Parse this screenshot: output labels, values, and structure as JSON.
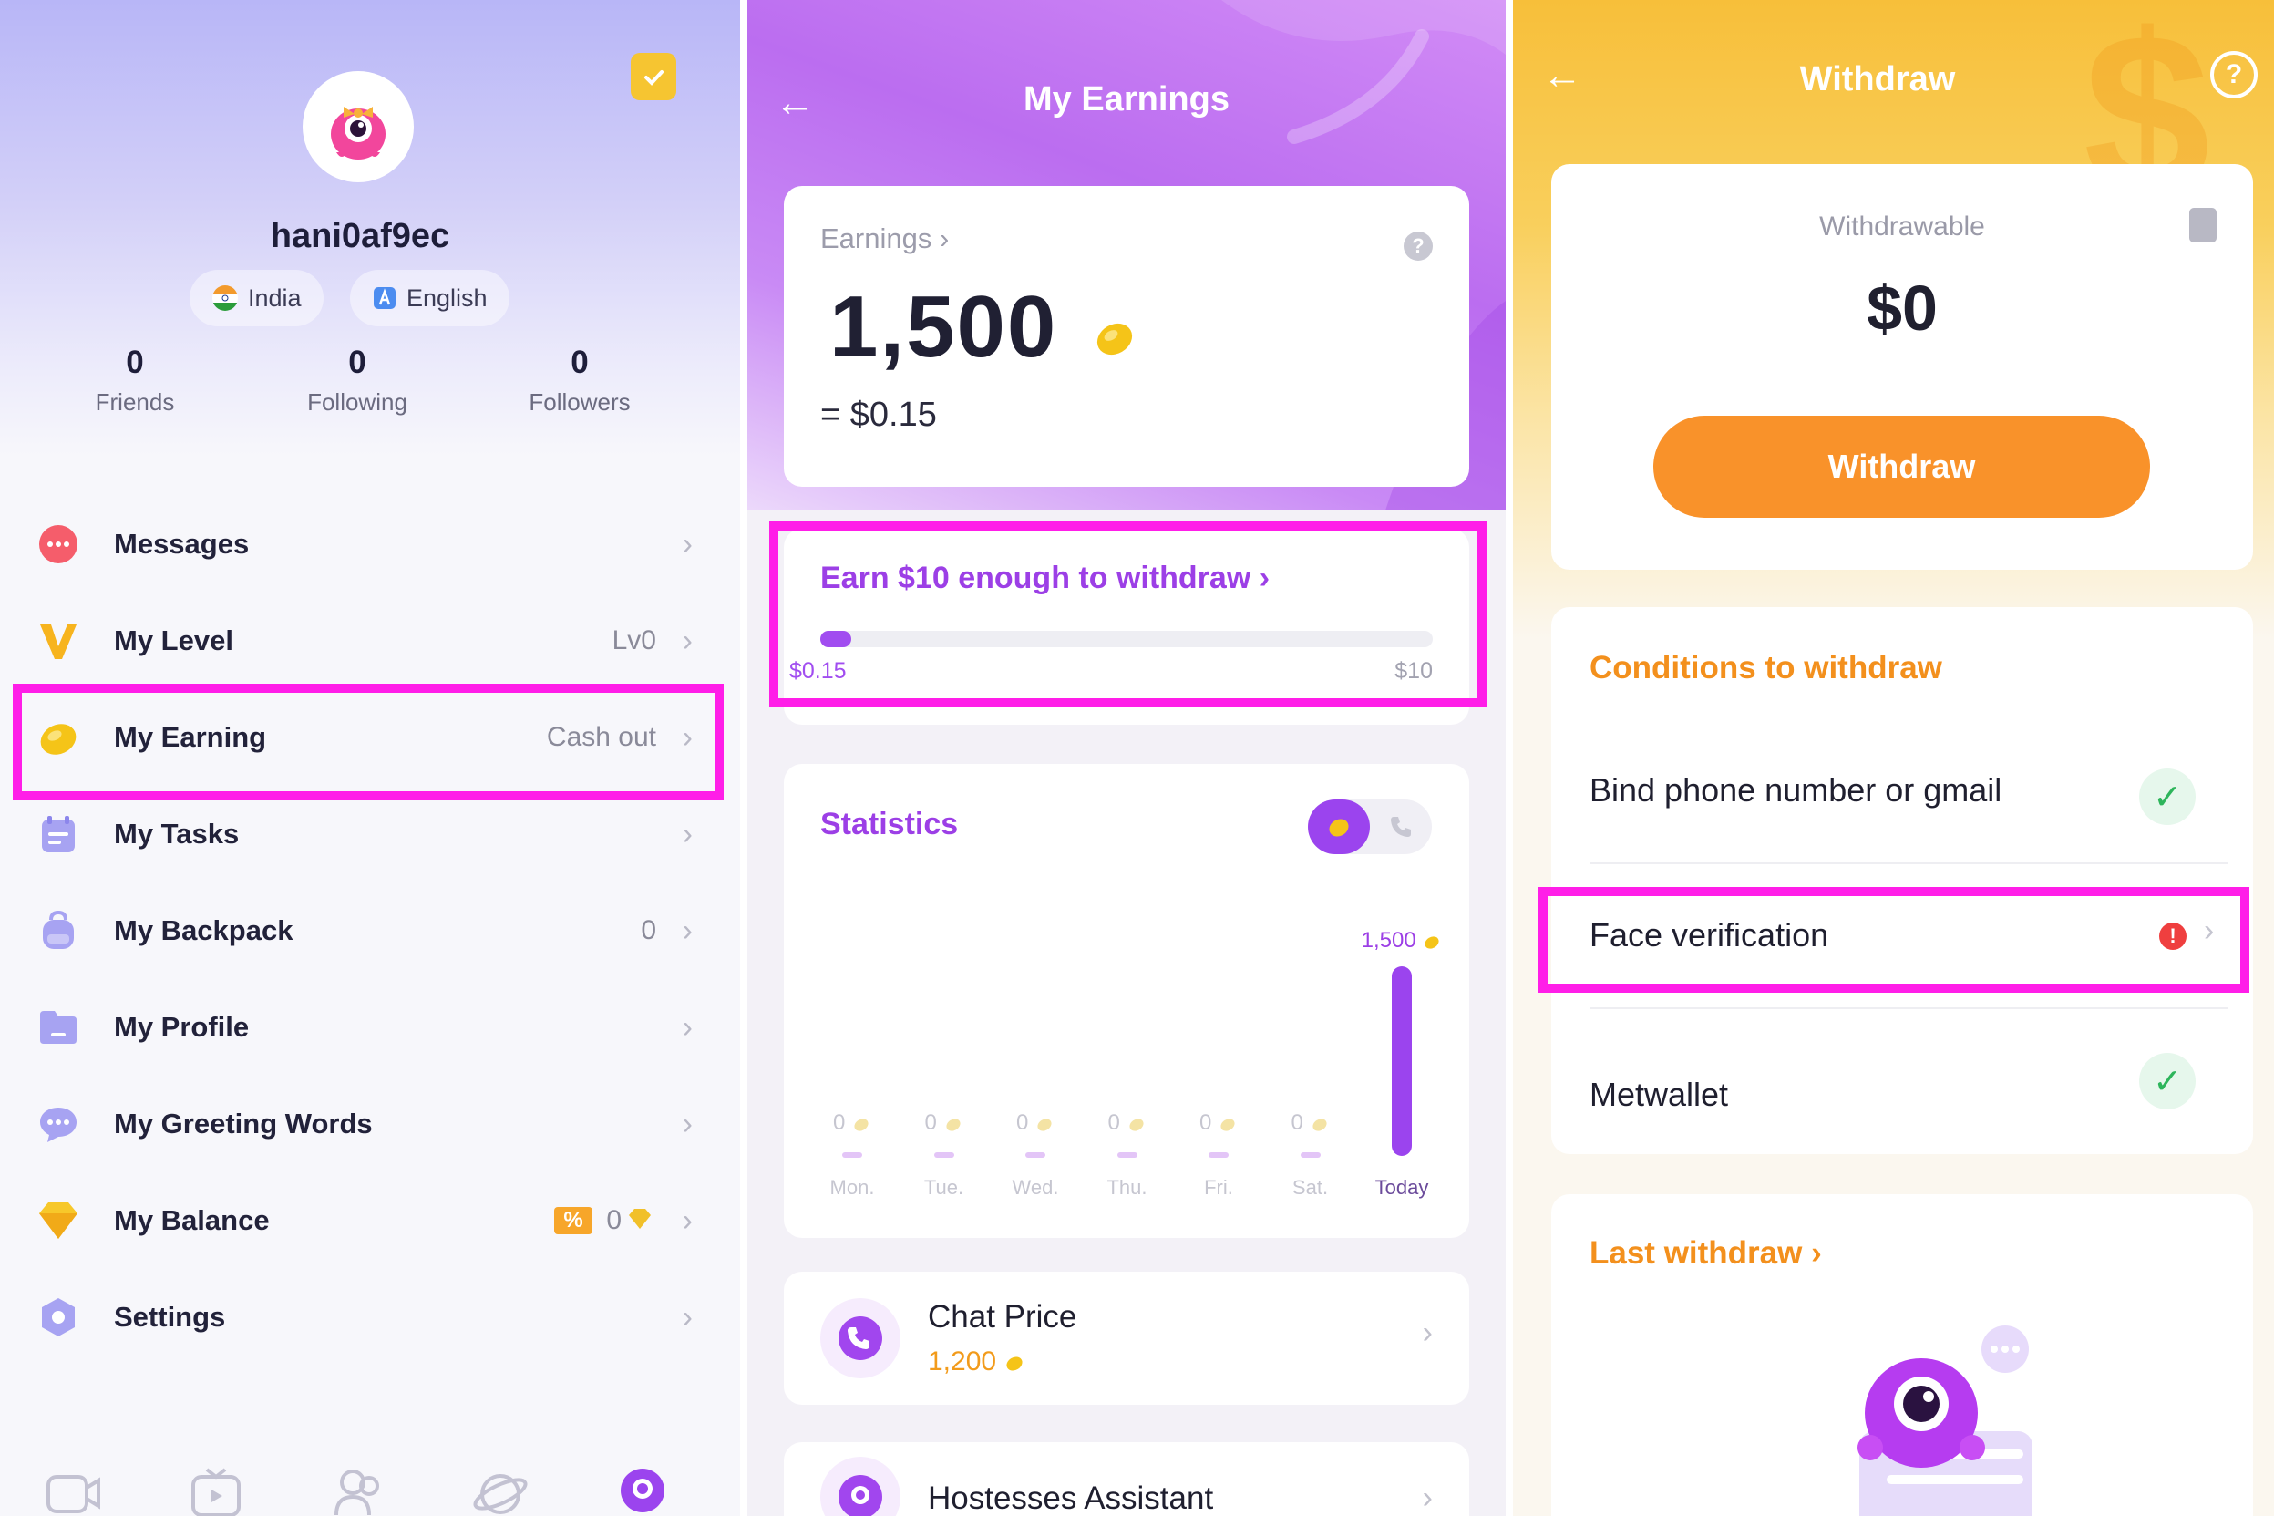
{
  "profile_screen": {
    "username": "hani0af9ec",
    "country_chip": "India",
    "language_chip": "English",
    "stats": [
      {
        "value": "0",
        "label": "Friends"
      },
      {
        "value": "0",
        "label": "Following"
      },
      {
        "value": "0",
        "label": "Followers"
      }
    ],
    "menu": [
      {
        "label": "Messages",
        "value": "",
        "icon": "chat-bubble-icon"
      },
      {
        "label": "My Level",
        "value": "Lv0",
        "icon": "level-v-icon"
      },
      {
        "label": "My Earning",
        "value": "Cash out",
        "icon": "coin-icon"
      },
      {
        "label": "My Tasks",
        "value": "",
        "icon": "task-list-icon"
      },
      {
        "label": "My Backpack",
        "value": "0",
        "icon": "backpack-icon"
      },
      {
        "label": "My Profile",
        "value": "",
        "icon": "folder-icon"
      },
      {
        "label": "My Greeting Words",
        "value": "",
        "icon": "greeting-bubble-icon"
      },
      {
        "label": "My Balance",
        "value": "0",
        "badge": "%",
        "icon": "diamond-icon"
      },
      {
        "label": "Settings",
        "value": "",
        "icon": "gear-hex-icon"
      }
    ],
    "tabs": [
      "video-call-icon",
      "live-tv-icon",
      "people-icon",
      "planet-icon",
      "me-avatar-icon"
    ],
    "colors": {
      "highlight": "#ff1ee8",
      "accent": "#9c3fe6"
    }
  },
  "earnings_screen": {
    "title": "My Earnings",
    "earnings_label": "Earnings",
    "earnings_value": "1,500",
    "earnings_usd": "= $0.15",
    "goal_text": "Earn $10 enough to withdraw",
    "goal_progress_fraction": 0.015,
    "goal_min_label": "$0.15",
    "goal_max_label": "$10",
    "statistics_title": "Statistics",
    "week": [
      {
        "day": "Mon.",
        "value": "0"
      },
      {
        "day": "Tue.",
        "value": "0"
      },
      {
        "day": "Wed.",
        "value": "0"
      },
      {
        "day": "Thu.",
        "value": "0"
      },
      {
        "day": "Fri.",
        "value": "0"
      },
      {
        "day": "Sat.",
        "value": "0"
      },
      {
        "day": "Today",
        "value": "1,500"
      }
    ],
    "chat_price_label": "Chat Price",
    "chat_price_value": "1,200",
    "assistant_label": "Hostesses Assistant"
  },
  "withdraw_screen": {
    "title": "Withdraw",
    "withdrawable_label": "Withdrawable",
    "withdrawable_amount": "$0",
    "withdraw_button": "Withdraw",
    "conditions_title": "Conditions to withdraw",
    "conditions": [
      {
        "label": "Bind phone number or gmail",
        "status": "done"
      },
      {
        "label": "Face verification",
        "status": "pending"
      },
      {
        "label": "Metwallet",
        "status": "done"
      }
    ],
    "last_withdraw_label": "Last withdraw",
    "colors": {
      "accent": "#f3901d",
      "button": "#f9922a"
    }
  }
}
